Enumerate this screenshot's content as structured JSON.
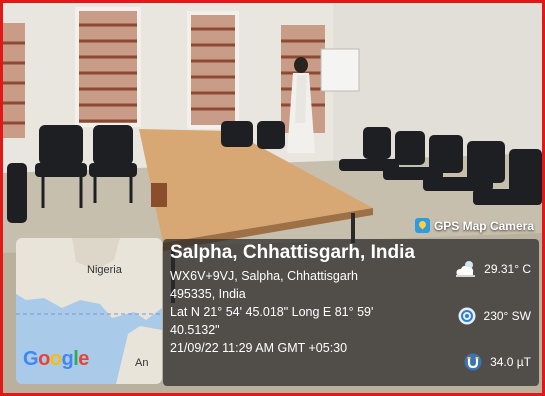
{
  "badge": {
    "label": "GPS Map Camera",
    "icon": "map-pin-icon"
  },
  "map": {
    "country_label": "Nigeria",
    "partial_label": "An",
    "logo_letters": [
      "G",
      "o",
      "o",
      "g",
      "l",
      "e"
    ],
    "colors": {
      "water": "#a9cbe9",
      "land": "#e8e4d9"
    }
  },
  "location": {
    "title": "Salpha, Chhattisgarh, India",
    "address_line1": "WX6V+9VJ, Salpha, Chhattisgarh",
    "address_line2": "495335, India",
    "coords_line1": "Lat N 21° 54' 45.018\" Long E 81° 59'",
    "coords_line2": "40.5132\"",
    "datetime": "21/09/22 11:29 AM GMT +05:30"
  },
  "metrics": {
    "temperature": "29.31° C",
    "wind": "230° SW",
    "magnetic": "34.0 µT"
  },
  "colors": {
    "border": "#e01818",
    "panel": "#282828"
  }
}
